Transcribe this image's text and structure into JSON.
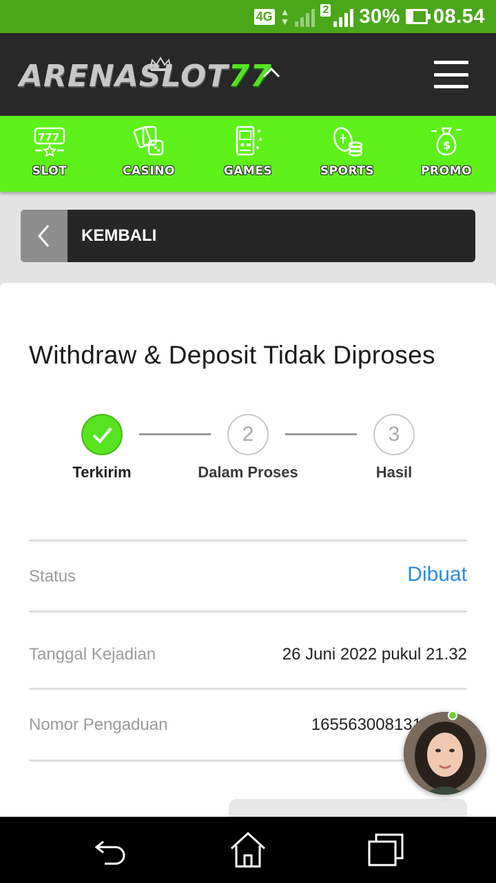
{
  "status_bar": {
    "network": "4G",
    "sim_slot": "2",
    "battery": "30%",
    "battery_level": 0.3,
    "time": "08.54"
  },
  "header": {
    "logo_text": "ARENASLOT",
    "logo_number": "77",
    "toggle_icon": "chevron-up-icon",
    "menu_icon": "hamburger-menu-icon"
  },
  "categories": [
    {
      "label": "SLOT",
      "icon": "slot-machine-icon"
    },
    {
      "label": "CASINO",
      "icon": "cards-dice-icon"
    },
    {
      "label": "GAMES",
      "icon": "arcade-icon"
    },
    {
      "label": "SPORTS",
      "icon": "football-coins-icon"
    },
    {
      "label": "PROMO",
      "icon": "money-bag-icon"
    }
  ],
  "back_bar": {
    "label": "KEMBALI",
    "icon": "chevron-left-icon"
  },
  "ticket": {
    "title": "Withdraw & Deposit Tidak Diproses",
    "steps": [
      {
        "number": "1",
        "label": "Terkirim",
        "completed": true
      },
      {
        "number": "2",
        "label": "Dalam Proses",
        "completed": false
      },
      {
        "number": "3",
        "label": "Hasil",
        "completed": false
      }
    ],
    "details": {
      "status_label": "Status",
      "status_value": "Dibuat",
      "date_label": "Tanggal Kejadian",
      "date_value": "26 Juni 2022 pukul 21.32",
      "number_label": "Nomor Pengaduan",
      "number_value": "165563008131"
    }
  },
  "colors": {
    "brand_green": "#5ef119",
    "status_bar_green": "#4aa71a",
    "header_dark": "#282828",
    "status_blue": "#2a8ddd"
  },
  "nav_bar": {
    "back_icon": "back-icon",
    "home_icon": "home-icon",
    "recents_icon": "recents-icon"
  }
}
